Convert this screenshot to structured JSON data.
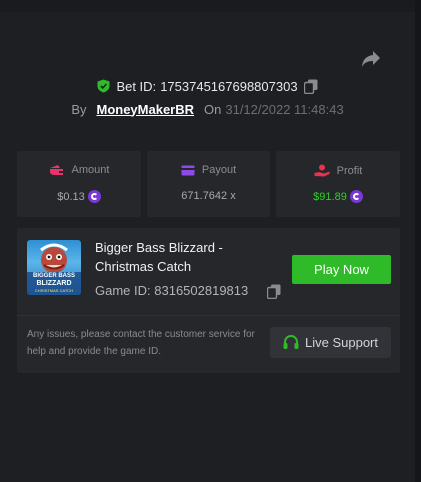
{
  "bet": {
    "id_label": "Bet ID:",
    "id_value": "1753745167698807303",
    "by_label": "By",
    "username": "MoneyMakerBR",
    "on_label": "On",
    "date": "31/12/2022 11:48:43"
  },
  "stats": [
    {
      "label": "Amount",
      "value": "$0.13",
      "icon": "wallet-icon"
    },
    {
      "label": "Payout",
      "value": "671.7642 x",
      "icon": "card-icon"
    },
    {
      "label": "Profit",
      "value": "$91.89",
      "icon": "profit-hand-icon"
    }
  ],
  "game": {
    "title": "Bigger Bass Blizzard - Christmas Catch",
    "id_label": "Game ID:",
    "id_value": "8316502819813",
    "thumb_text_line1": "BIGGER BASS",
    "thumb_text_line2": "BLIZZARD",
    "thumb_text_line3": "CHRISTMAS CATCH",
    "play_label": "Play Now"
  },
  "support": {
    "text": "Any issues, please contact the customer service for help and provide the game ID.",
    "button_label": "Live Support"
  },
  "colors": {
    "background": "#1e1f22",
    "card": "#26272b",
    "accent_green": "#2fba2a",
    "profit_green": "#2fd12a",
    "coin_purple": "#7a38d8",
    "icon_pink": "#e8336d",
    "icon_purple": "#8d4ae8",
    "icon_red": "#e8334a"
  }
}
